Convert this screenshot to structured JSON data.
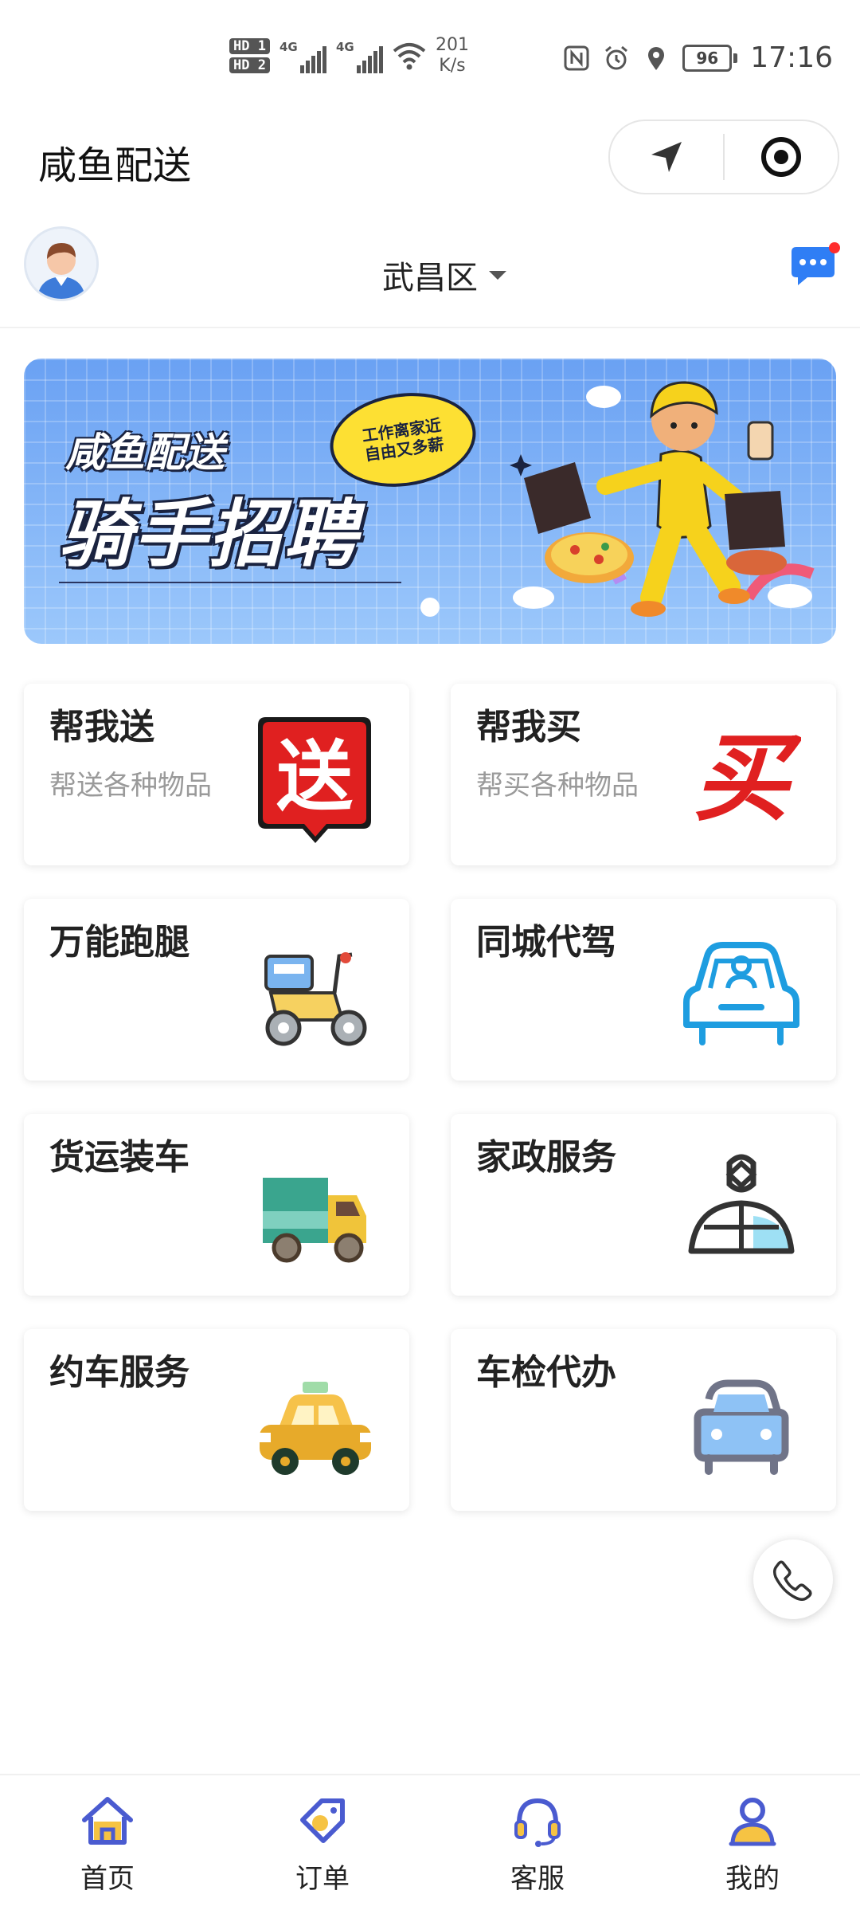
{
  "status_bar": {
    "hd1": "HD 1",
    "hd2": "HD 2",
    "net1": "4G",
    "net2": "4G",
    "speed_value": "201",
    "speed_unit": "K/s",
    "battery": "96",
    "time": "17:16"
  },
  "title_bar": {
    "title": "咸鱼配送"
  },
  "header": {
    "district": "武昌区"
  },
  "banner": {
    "subtitle": "咸鱼配送",
    "title": "骑手招聘",
    "bubble_line1": "工作离家近",
    "bubble_line2": "自由又多薪"
  },
  "services": [
    {
      "title": "帮我送",
      "subtitle": "帮送各种物品",
      "icon": "deliver-icon"
    },
    {
      "title": "帮我买",
      "subtitle": "帮买各种物品",
      "icon": "buy-icon"
    },
    {
      "title": "万能跑腿",
      "subtitle": "",
      "icon": "scooter-icon"
    },
    {
      "title": "同城代驾",
      "subtitle": "",
      "icon": "driver-car-icon"
    },
    {
      "title": "货运装车",
      "subtitle": "",
      "icon": "truck-icon"
    },
    {
      "title": "家政服务",
      "subtitle": "",
      "icon": "housekeeping-icon"
    },
    {
      "title": "约车服务",
      "subtitle": "",
      "icon": "taxi-icon"
    },
    {
      "title": "车检代办",
      "subtitle": "",
      "icon": "car-inspection-icon"
    }
  ],
  "tabs": [
    {
      "label": "首页",
      "icon": "home-icon"
    },
    {
      "label": "订单",
      "icon": "order-tag-icon"
    },
    {
      "label": "客服",
      "icon": "headset-icon"
    },
    {
      "label": "我的",
      "icon": "profile-icon"
    }
  ],
  "colors": {
    "brand_red": "#e02020",
    "tab_icon_blue": "#4a5bd0",
    "tab_icon_yellow": "#f6c343",
    "banner_blue": "#7fb0f6"
  }
}
